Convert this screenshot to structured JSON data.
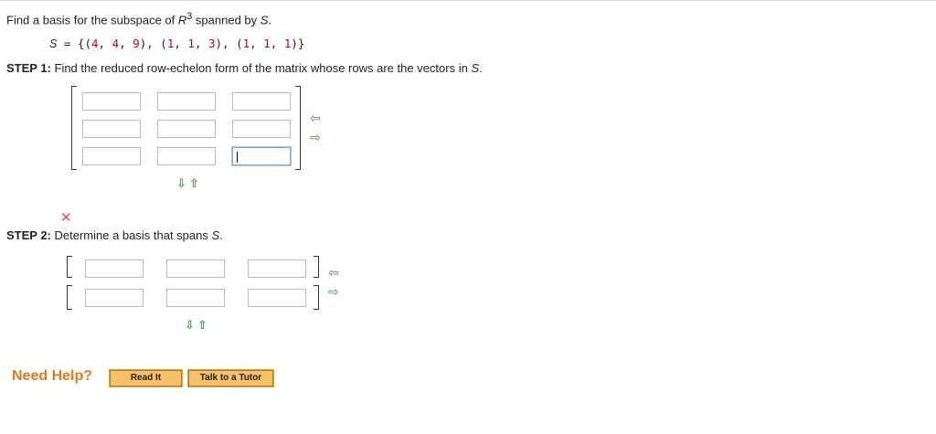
{
  "question": {
    "prefix": "Find a basis for the subspace of ",
    "space": "R",
    "exponent": "3",
    "middle": " spanned by ",
    "set_name": "S",
    "end": "."
  },
  "set": {
    "name": "S",
    "eq": " = {(",
    "vectors": [
      [
        "4",
        "4",
        "9"
      ],
      [
        "1",
        "1",
        "3"
      ],
      [
        "1",
        "1",
        "1"
      ]
    ],
    "sep": ", ",
    "close": ")}"
  },
  "step1": {
    "label": "STEP 1:",
    "text": " Find the reduced row-echelon form of the matrix whose rows are the vectors in ",
    "set_name": "S",
    "end": ".",
    "cells": [
      [
        "",
        "",
        ""
      ],
      [
        "",
        "",
        ""
      ],
      [
        "",
        "",
        ""
      ]
    ]
  },
  "step2": {
    "label": "STEP 2:",
    "text": " Determine a basis that spans ",
    "set_name": "S",
    "end": ".",
    "cells": [
      [
        "",
        "",
        ""
      ],
      [
        "",
        "",
        ""
      ]
    ]
  },
  "status_icon": "red-x-icon",
  "icons": {
    "add_col": "⇦",
    "remove_col": "⇨",
    "down": "⇩",
    "up": "⇧"
  },
  "help": {
    "label": "Need Help?",
    "read_it": "Read It",
    "talk_tutor": "Talk to a Tutor"
  },
  "colors": {
    "help_orange": "#e07a1a",
    "button_fill": "#f6c169",
    "arrow_green": "#3c9a3c",
    "error_red": "#e05050"
  }
}
